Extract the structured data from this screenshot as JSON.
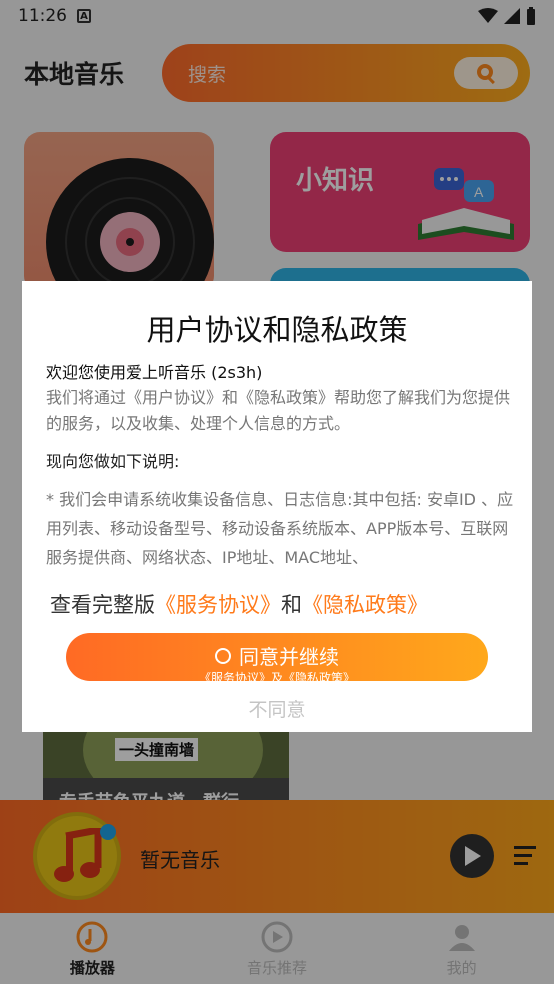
{
  "status_bar": {
    "time": "11:26"
  },
  "header": {
    "title": "本地音乐",
    "search_placeholder": "搜索"
  },
  "cards": {
    "tips_title": "小知识",
    "thumb_caption": "一头撞南墙",
    "thumb_subtitle": "专手节鱼平九道，群行"
  },
  "player": {
    "track": "暂无音乐"
  },
  "nav": {
    "items": [
      {
        "label": "播放器"
      },
      {
        "label": "音乐推荐"
      },
      {
        "label": "我的"
      }
    ]
  },
  "dialog": {
    "title": "用户协议和隐私政策",
    "welcome": "欢迎您使用爱上听音乐 (2s3h)",
    "intro": "我们将通过《用户协议》和《隐私政策》帮助您了解我们为您提供的服务，以及收集、处理个人信息的方式。",
    "section": "现向您做如下说明:",
    "bullet": "* 我们会申请系统收集设备信息、日志信息:其中包括: 安卓ID 、应用列表、移动设备型号、移动设备系统版本、APP版本号、互联网服务提供商、网络状态、IP地址、MAC地址、",
    "links_prefix": "查看完整版",
    "link_service": "《服务协议》",
    "links_and": "和",
    "link_privacy": "《隐私政策》",
    "agree_label": "同意并继续",
    "agree_sub": "《服务协议》及《隐私政策》",
    "disagree_label": "不同意"
  },
  "colors": {
    "accent_start": "#ff6a24",
    "accent_end": "#ffa81b",
    "link": "#ff7a1a"
  }
}
